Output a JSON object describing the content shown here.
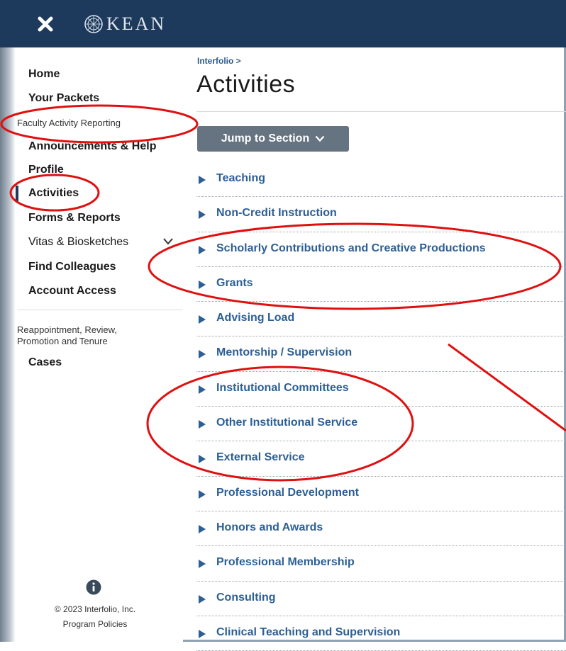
{
  "header": {
    "close_label": "close",
    "logo_text": "KEAN"
  },
  "sidebar": {
    "home": "Home",
    "your_packets": "Your Packets",
    "section_far": "Faculty Activity Reporting",
    "items": [
      "Announcements & Help",
      "Profile",
      "Activities",
      "Forms & Reports",
      "Vitas & Biosketches",
      "Find Colleagues",
      "Account Access"
    ],
    "section_rpt_line1": "Reappointment, Review,",
    "section_rpt_line2": "Promotion and Tenure",
    "cases": "Cases",
    "copyright": "© 2023 Interfolio, Inc.",
    "policies": "Program Policies"
  },
  "main": {
    "breadcrumb": "Interfolio >",
    "title": "Activities",
    "jump_label": "Jump to Section",
    "sections": [
      "Teaching",
      "Non-Credit Instruction",
      "Scholarly Contributions and Creative Productions",
      "Grants",
      "Advising Load",
      "Mentorship / Supervision",
      "Institutional Committees",
      "Other Institutional Service",
      "External Service",
      "Professional Development",
      "Honors and Awards",
      "Professional Membership",
      "Consulting",
      "Clinical Teaching and Supervision"
    ]
  },
  "colors": {
    "header_bg": "#1d3a5c",
    "link_blue": "#2c5f95",
    "annotation_red": "#e01010",
    "button_gray": "#667380"
  }
}
